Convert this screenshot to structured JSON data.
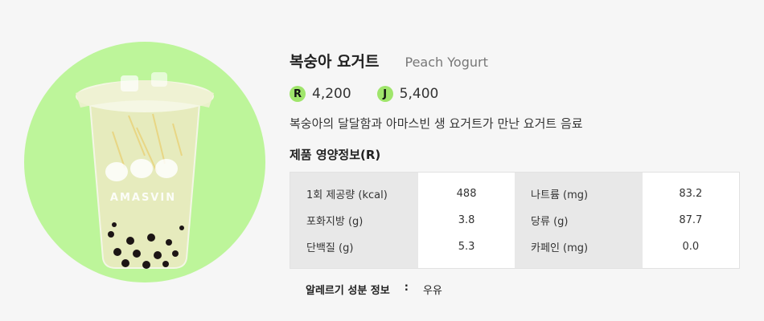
{
  "product": {
    "name_ko": "복숭아 요거트",
    "name_en": "Peach Yogurt",
    "cup_logo_text": "AMASVIN",
    "prices": [
      {
        "size": "R",
        "price": "4,200"
      },
      {
        "size": "J",
        "price": "5,400"
      }
    ],
    "description": "복숭아의 달달함과 아마스빈 생 요거트가 만난 요거트 음료"
  },
  "nutrition": {
    "title": "제품 영양정보(R)",
    "rows": [
      [
        {
          "label": "1회 제공량 (kcal)",
          "value": "488"
        },
        {
          "label": "나트륨 (mg)",
          "value": "83.2"
        }
      ],
      [
        {
          "label": "포화지방 (g)",
          "value": "3.8"
        },
        {
          "label": "당류 (g)",
          "value": "87.7"
        }
      ],
      [
        {
          "label": "단백질 (g)",
          "value": "5.3"
        },
        {
          "label": "카페인 (mg)",
          "value": "0.0"
        }
      ]
    ]
  },
  "allergy": {
    "label": "알레르기 성분 정보",
    "separator": ":",
    "value": "우유"
  },
  "colors": {
    "circle_bg": "#bdf59a",
    "badge": "#9fe56b",
    "drink": "#e7ecc0",
    "pearl": "#1c1515"
  }
}
